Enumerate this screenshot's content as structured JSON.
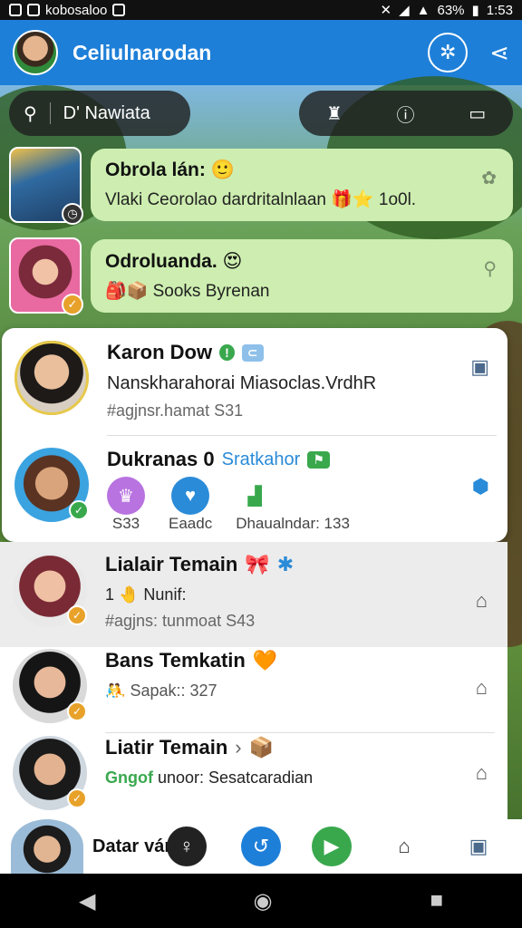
{
  "status": {
    "carrier": "kobosaloo",
    "battery": "63%",
    "time": "1:53"
  },
  "header": {
    "title": "Celiulnarodan"
  },
  "search": {
    "label": "D' Nawiata"
  },
  "bubbles": [
    {
      "title": "Obrola lán:",
      "emoji": "🙂",
      "text": "Vlaki Ceorolao dardritalnlaan",
      "extra": "1o0l."
    },
    {
      "title": "Odroluanda.",
      "emoji": "😍",
      "text": "Sooks Byrenan"
    }
  ],
  "card_items": [
    {
      "name": "Karon Dow",
      "subtitle": "Nanskharahorai Miasoclas.VrdhR",
      "meta": "#agjnsr.hamat S31"
    },
    {
      "name": "Dukranas 0",
      "tag": "Sratkahor",
      "stat1": "Eaadc",
      "stat2": "Dhaualndar: 133",
      "badge_count": "S33"
    }
  ],
  "list_items": [
    {
      "name": "Lialair Temain",
      "subtitle": "1 🤚 Nunif:",
      "meta": "#agjns: tunmoat S43"
    },
    {
      "name": "Bans Temkatin",
      "subtitle": "Sapak:: 327"
    },
    {
      "name": "Liatir Temain",
      "chev": "›",
      "prefix": "Gngof",
      "subtitle": "unoor: Sesatcaradian"
    }
  ],
  "bottom": {
    "label": "Datar",
    "label2": "ván"
  },
  "colors": {
    "primary": "#1e7fd8",
    "bubble": "#cdeeb0",
    "accent": "#e8a22a",
    "green": "#39a84d"
  }
}
